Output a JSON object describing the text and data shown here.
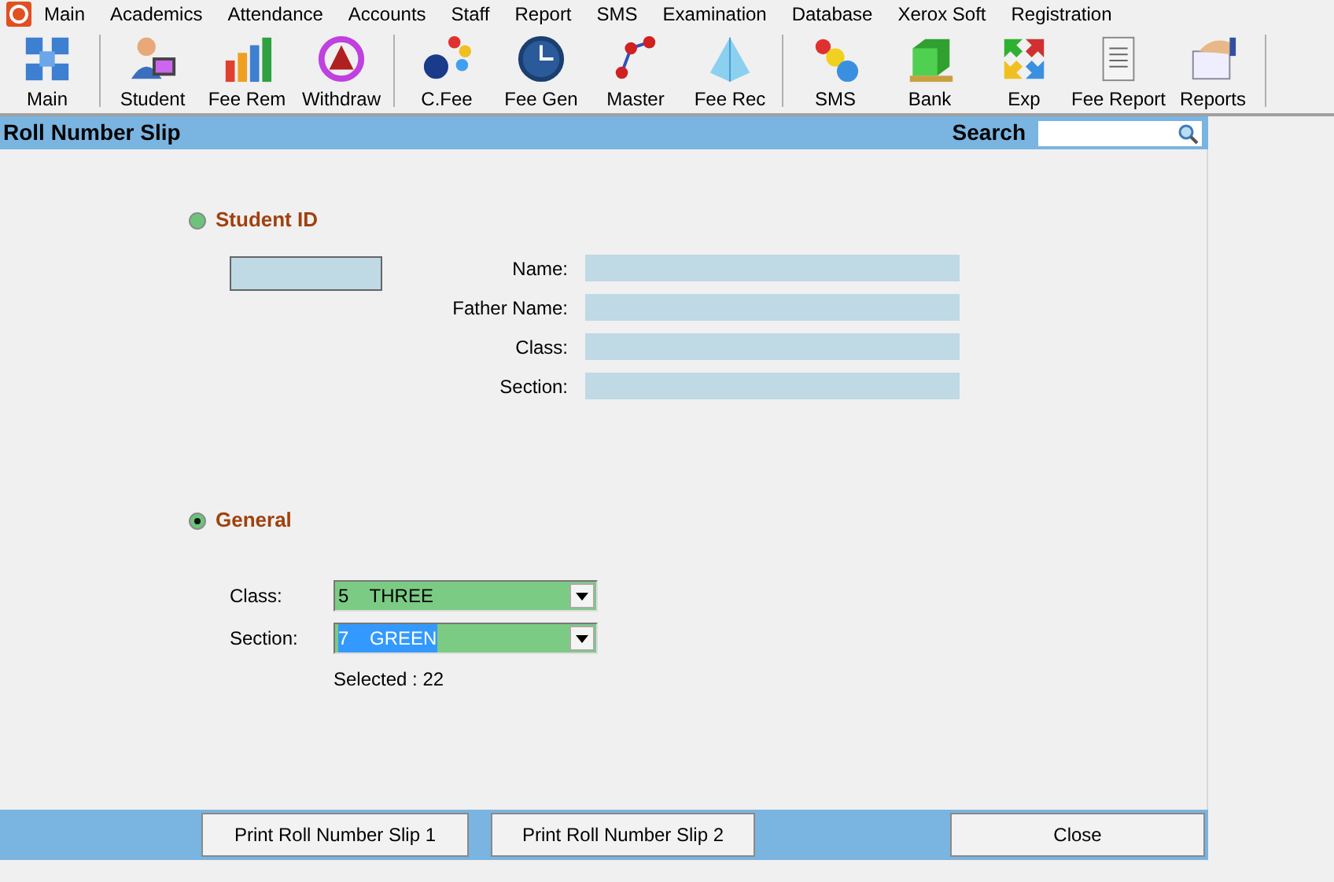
{
  "menu": [
    "Main",
    "Academics",
    "Attendance",
    "Accounts",
    "Staff",
    "Report",
    "SMS",
    "Examination",
    "Database",
    "Xerox Soft",
    "Registration"
  ],
  "toolbar_groups": [
    [
      "Main"
    ],
    [
      "Student",
      "Fee Rem",
      "Withdraw"
    ],
    [
      "C.Fee",
      "Fee Gen",
      "Master",
      "Fee Rec"
    ],
    [
      "SMS",
      "Bank",
      "Exp",
      "Fee Report",
      "Reports"
    ]
  ],
  "title": "Roll Number Slip",
  "search": {
    "label": "Search"
  },
  "options": [
    {
      "label": "Student ID",
      "selected": false
    },
    {
      "label": "General",
      "selected": true
    }
  ],
  "student_fields": [
    "Name:",
    "Father Name:",
    "Class:",
    "Section:"
  ],
  "general": {
    "fields": [
      {
        "label": "Class:",
        "code": "5",
        "name": "THREE",
        "highlighted": false
      },
      {
        "label": "Section:",
        "code": "7",
        "name": "GREEN",
        "highlighted": true
      }
    ],
    "selected_text": "Selected : 22"
  },
  "buttons": [
    "Print Roll Number Slip 1",
    "Print Roll Number Slip 2",
    "Close"
  ]
}
